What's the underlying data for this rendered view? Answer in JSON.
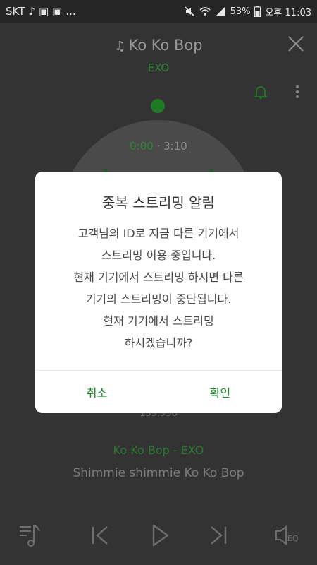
{
  "status_bar": {
    "carrier": "SKT",
    "extra_icons": "...",
    "battery": "53%",
    "time": "오후 11:03"
  },
  "player": {
    "song_title": "Ko Ko Bop",
    "artist": "EXO",
    "time_current": "0:00",
    "time_separator": " · ",
    "time_total": "3:10",
    "likes": "159,958",
    "lyric_current": "Ko Ko Bop - EXO",
    "lyric_next": "Shimmie shimmie Ko Ko Bop",
    "accent_color": "#1f7a26"
  },
  "dialog": {
    "title": "중복 스트리밍 알림",
    "message_lines": [
      "고객님의 ID로 지금 다른 기기에서",
      "스트리밍 이용 중입니다.",
      "현재 기기에서 스트리밍 하시면 다른",
      "기기의 스트리밍이 중단됩니다.",
      "현재 기기에서 스트리밍",
      "하시겠습니까?"
    ],
    "cancel_label": "취소",
    "confirm_label": "확인",
    "button_color": "#1a8b28"
  }
}
